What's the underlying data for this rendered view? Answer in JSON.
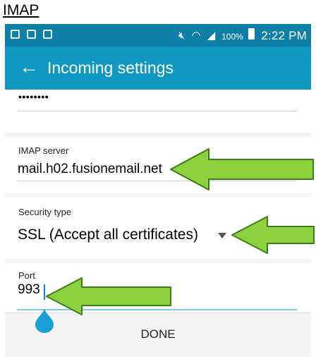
{
  "caption": "IMAP",
  "status_bar": {
    "battery_text": "100%",
    "time": "2:22 PM"
  },
  "app_bar": {
    "title": "Incoming settings"
  },
  "password_field": {
    "value": "••••••••"
  },
  "imap_server": {
    "label": "IMAP server",
    "value": "mail.h02.fusionemail.net"
  },
  "security_type": {
    "label": "Security type",
    "value": "SSL (Accept all certificates)"
  },
  "port": {
    "label": "Port",
    "value": "993"
  },
  "bottom_bar": {
    "done_label": "DONE"
  },
  "colors": {
    "status_bar": "#0e7fa6",
    "app_bar": "#1198c2",
    "arrow_fill": "#8cd23f",
    "arrow_stroke": "#3e7d1b",
    "cursor_handle": "#1a9fd6"
  }
}
